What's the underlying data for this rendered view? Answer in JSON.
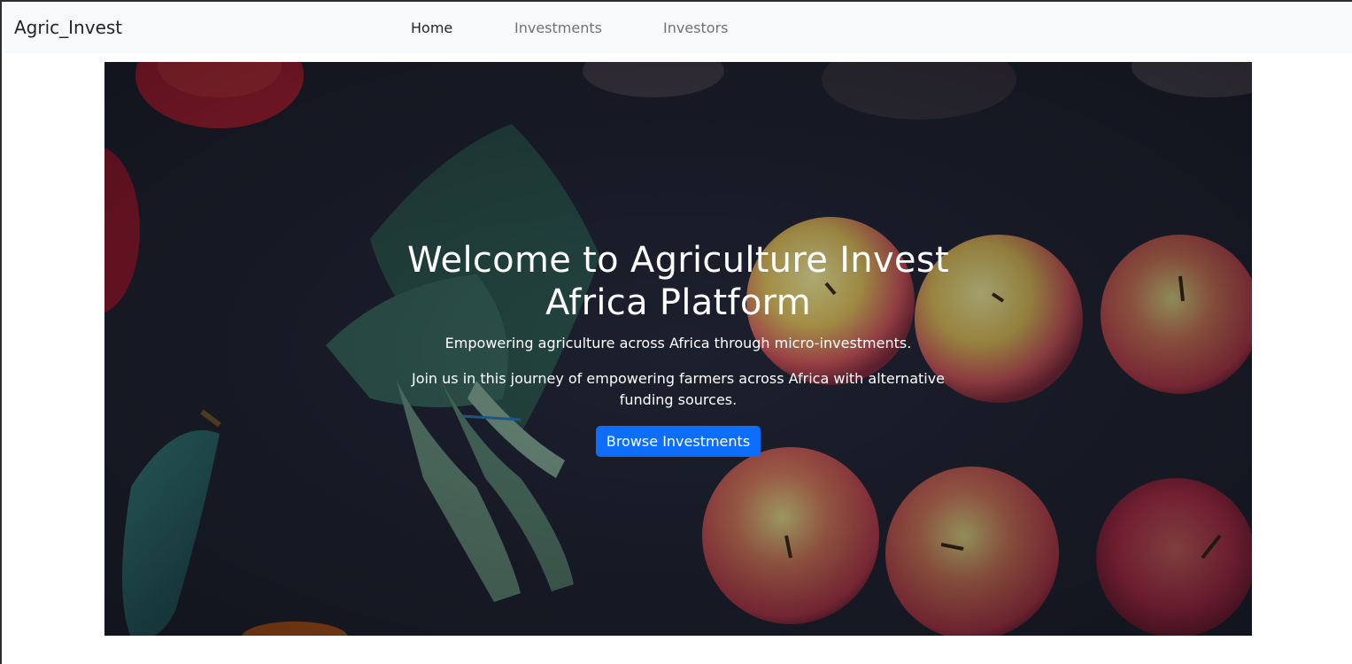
{
  "navbar": {
    "brand": "Agric_Invest",
    "links": [
      {
        "label": "Home",
        "active": true
      },
      {
        "label": "Investments",
        "active": false
      },
      {
        "label": "Investors",
        "active": false
      }
    ]
  },
  "hero": {
    "title": "Welcome to Agriculture Invest Africa Platform",
    "subtitle": "Empowering agriculture across Africa through micro-investments.",
    "description": "Join us in this journey of empowering farmers across Africa with alternative funding sources.",
    "cta_label": "Browse Investments",
    "background_image": "dark tabletop with apples, arugula bunch and cucumber"
  },
  "colors": {
    "accent": "#0d6efd",
    "navbar_bg": "#f8f9fa",
    "hero_bg": "#242537"
  }
}
